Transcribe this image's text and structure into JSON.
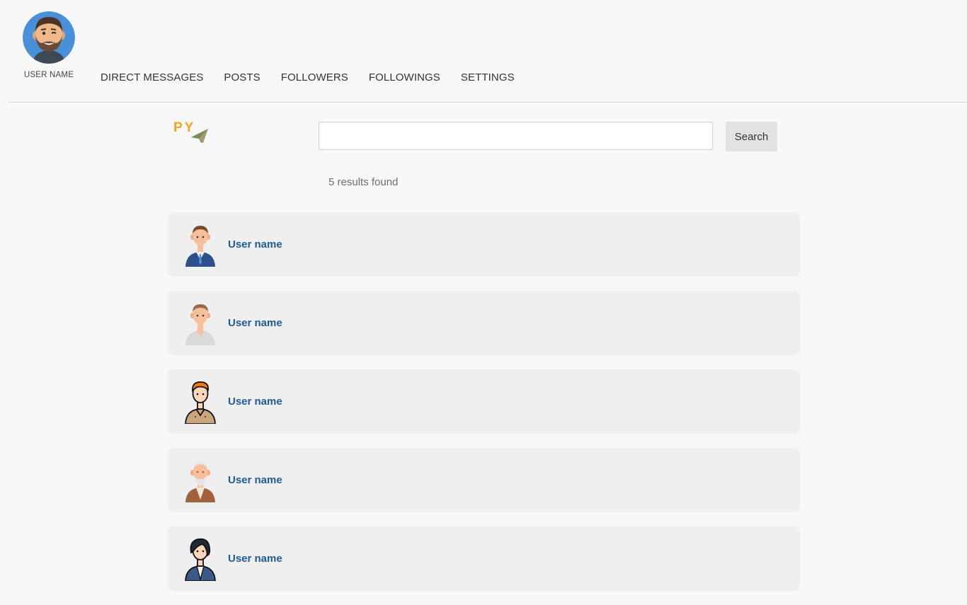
{
  "profile": {
    "name": "USER NAME",
    "avatar_icon": "bearded-man-avatar-icon"
  },
  "nav": {
    "items": [
      {
        "label": "DIRECT MESSAGES"
      },
      {
        "label": "POSTS"
      },
      {
        "label": "FOLLOWERS"
      },
      {
        "label": "FOLLOWINGS"
      },
      {
        "label": "SETTINGS"
      }
    ]
  },
  "logo": {
    "text": "PY",
    "icon": "paper-plane-icon"
  },
  "search": {
    "value": "",
    "placeholder": "",
    "button_label": "Search"
  },
  "results": {
    "count_text": "5 results found",
    "items": [
      {
        "name": "User name",
        "avatar_icon": "businessman-avatar-icon"
      },
      {
        "name": "User name",
        "avatar_icon": "casual-man-avatar-icon"
      },
      {
        "name": "User name",
        "avatar_icon": "redhead-man-avatar-icon"
      },
      {
        "name": "User name",
        "avatar_icon": "old-man-avatar-icon"
      },
      {
        "name": "User name",
        "avatar_icon": "curly-hair-man-avatar-icon"
      }
    ]
  },
  "colors": {
    "background": "#f8f8f8",
    "card": "#efefef",
    "link": "#1f5b95",
    "logo": "#f4a12a"
  }
}
